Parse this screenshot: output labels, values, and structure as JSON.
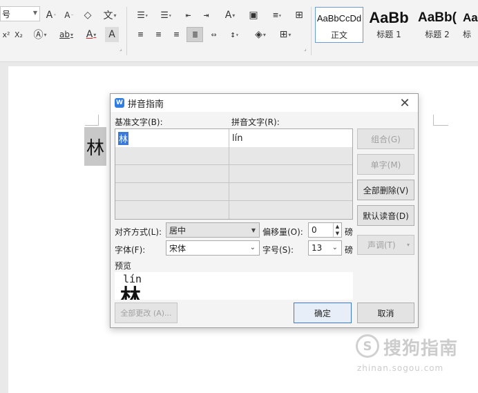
{
  "ribbon": {
    "font_size_value": "号",
    "row1_icons": [
      "grow-font-icon",
      "shrink-font-icon",
      "clear-format-icon",
      "pinyin-guide-icon",
      "bullets-icon",
      "numbering-icon",
      "decrease-indent-icon",
      "increase-indent-icon",
      "text-direction-icon",
      "char-border-icon",
      "line-spacing-icon",
      "table-icon"
    ],
    "row2_icons": [
      "superscript-icon",
      "subscript-icon",
      "text-effect-icon",
      "highlight-icon",
      "font-color-icon",
      "char-shading-icon",
      "align-left-icon",
      "align-center-icon",
      "align-right-icon",
      "justify-icon",
      "distribute-icon",
      "paragraph-spacing-icon",
      "shading-icon",
      "borders-icon"
    ],
    "styles": [
      {
        "preview": "AaBbCcDd",
        "name": "正文"
      },
      {
        "preview": "AaBb",
        "name": "标题 1"
      },
      {
        "preview": "AaBb(",
        "name": "标题 2"
      },
      {
        "preview": "Aa",
        "name": "标"
      }
    ]
  },
  "document": {
    "selected_char": "林"
  },
  "dialog": {
    "title": "拼音指南",
    "col_base_label": "基准文字(B):",
    "col_pinyin_label": "拼音文字(R):",
    "rows": [
      {
        "base": "林",
        "pinyin": "lín"
      },
      {
        "base": "",
        "pinyin": ""
      },
      {
        "base": "",
        "pinyin": ""
      },
      {
        "base": "",
        "pinyin": ""
      },
      {
        "base": "",
        "pinyin": ""
      }
    ],
    "buttons": {
      "group": "组合(G)",
      "single": "单字(M)",
      "clear_all": "全部删除(V)",
      "default_reading": "默认读音(D)",
      "tone": "声调(T)",
      "change_all": "全部更改 (A)...",
      "ok": "确定",
      "cancel": "取消"
    },
    "alignment_label": "对齐方式(L):",
    "alignment_value": "居中",
    "offset_label": "偏移量(O):",
    "offset_value": "0",
    "offset_unit": "磅",
    "font_label": "字体(F):",
    "font_value": "宋体",
    "size_label": "字号(S):",
    "size_value": "13",
    "size_unit": "磅",
    "preview_label": "预览",
    "preview_pinyin": "lín",
    "preview_char": "林"
  },
  "watermark": {
    "logo": "S",
    "text": "搜狗指南",
    "url": "zhinan.sogou.com"
  }
}
